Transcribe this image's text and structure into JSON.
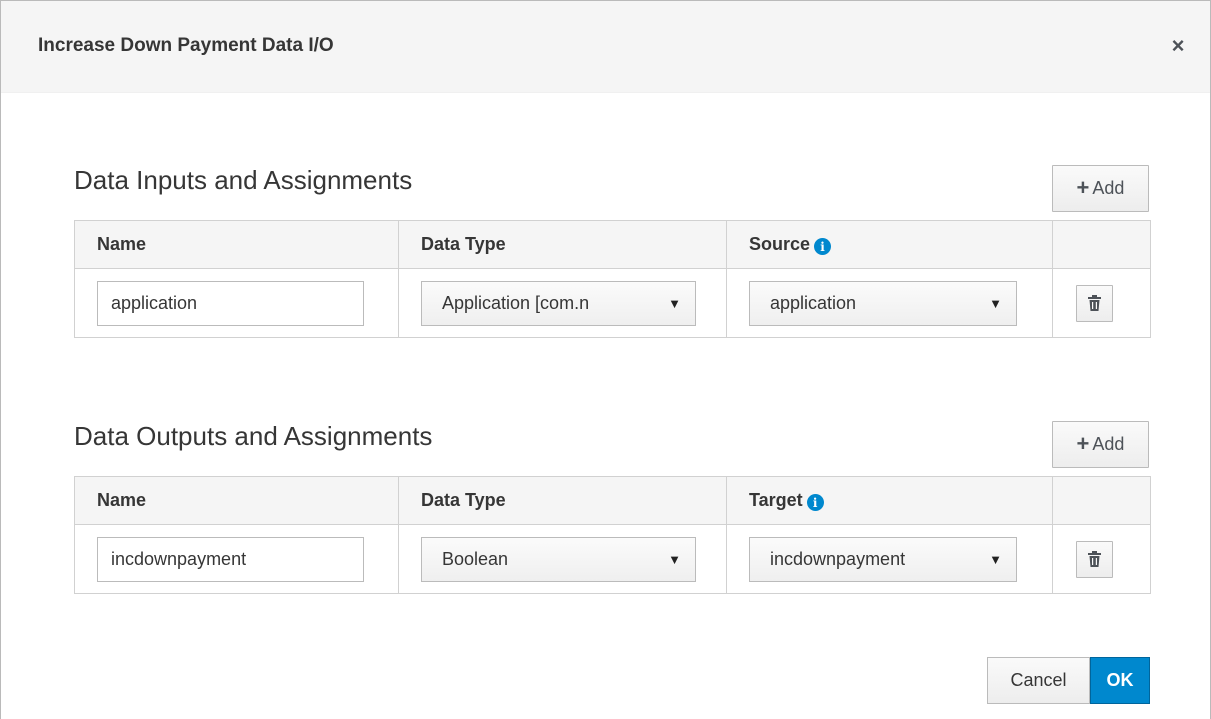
{
  "dialog": {
    "title": "Increase Down Payment Data I/O",
    "close_label": "×"
  },
  "inputs": {
    "title": "Data Inputs and Assignments",
    "add_label": "Add",
    "headers": {
      "name": "Name",
      "type": "Data Type",
      "source": "Source"
    },
    "rows": [
      {
        "name": "application",
        "type": "Application [com.n",
        "source": "application"
      }
    ]
  },
  "outputs": {
    "title": "Data Outputs and Assignments",
    "add_label": "Add",
    "headers": {
      "name": "Name",
      "type": "Data Type",
      "target": "Target"
    },
    "rows": [
      {
        "name": "incdownpayment",
        "type": "Boolean",
        "target": "incdownpayment"
      }
    ]
  },
  "footer": {
    "cancel_label": "Cancel",
    "ok_label": "OK"
  },
  "icons": {
    "info": "info-circle-icon",
    "trash": "trash-icon",
    "plus": "plus-icon",
    "dropdown": "caret-down-icon"
  },
  "colors": {
    "primary": "#0088ce",
    "header_bg": "#f5f5f5",
    "border": "#d1d1d1"
  }
}
